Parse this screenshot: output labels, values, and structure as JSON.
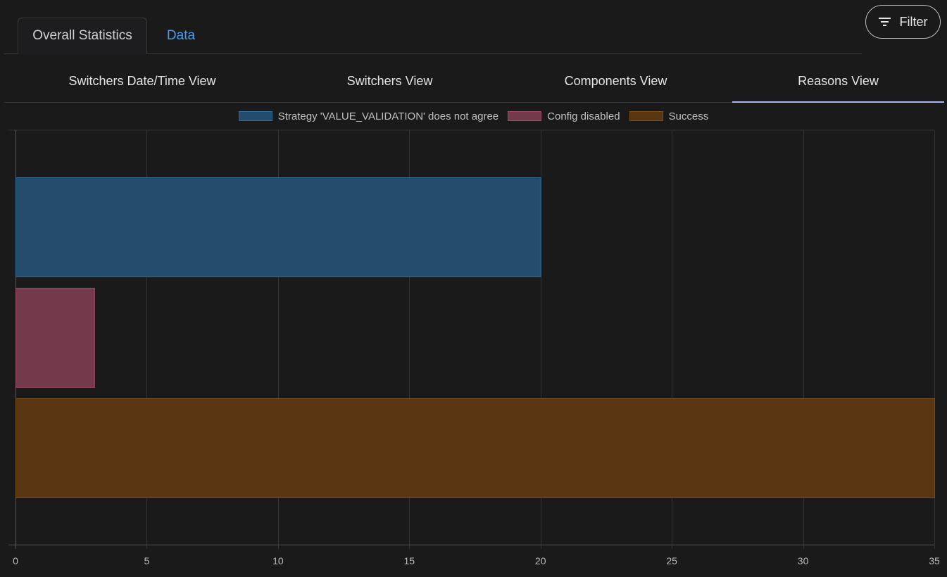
{
  "top_tabs": {
    "overall": "Overall Statistics",
    "data": "Data"
  },
  "filter": {
    "label": "Filter",
    "icon": "filter-icon"
  },
  "sub_tabs": [
    {
      "label": "Switchers Date/Time View"
    },
    {
      "label": "Switchers View"
    },
    {
      "label": "Components View"
    },
    {
      "label": "Reasons View",
      "active": true
    }
  ],
  "colors": {
    "accent_link": "#4a9df0",
    "active_tab_underline": "#a9b4f5"
  },
  "chart_data": {
    "type": "bar",
    "orientation": "horizontal",
    "x_ticks": [
      0,
      5,
      10,
      15,
      20,
      25,
      30,
      35
    ],
    "xlim": [
      0,
      35
    ],
    "grid": true,
    "legend_position": "top-center",
    "series": [
      {
        "name": "Strategy 'VALUE_VALIDATION' does not agree",
        "value": 20,
        "fill": "#244d6d",
        "stroke": "#2f6a96"
      },
      {
        "name": "Config disabled",
        "value": 3,
        "fill": "#723a4a",
        "stroke": "#9a4c62"
      },
      {
        "name": "Success",
        "value": 35,
        "fill": "#5a3511",
        "stroke": "#7a4a17"
      }
    ]
  }
}
